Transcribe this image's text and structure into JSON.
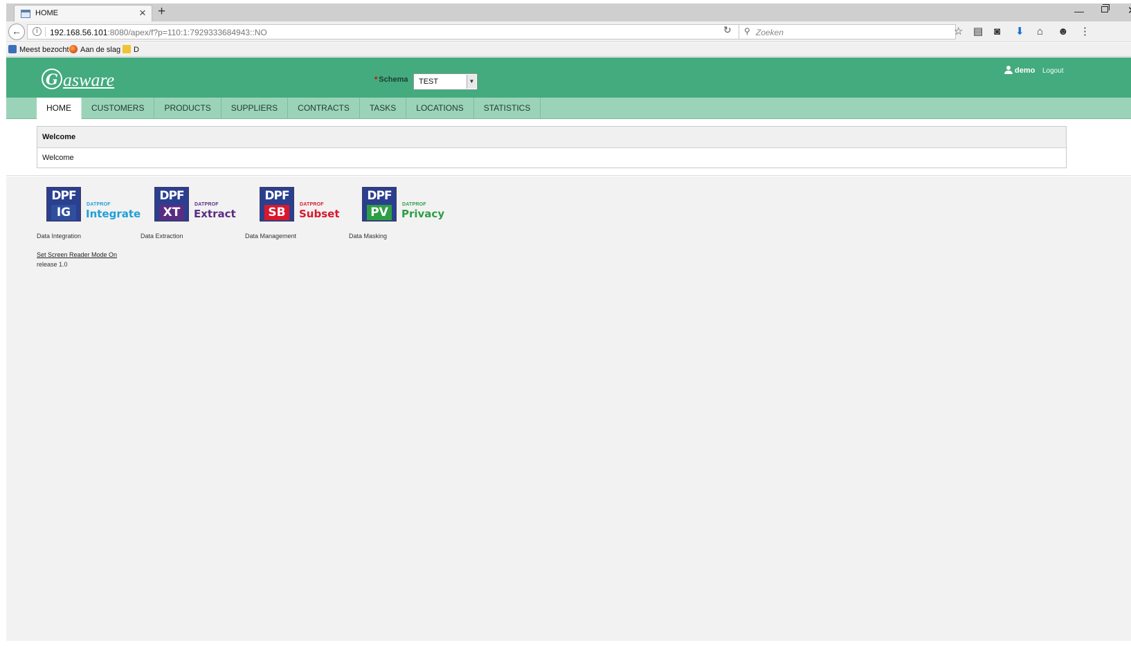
{
  "browser": {
    "tab_title": "HOME",
    "tab_close": "×",
    "new_tab": "+",
    "url_host": "192.168.56.101",
    "url_rest": ":8080/apex/f?p=110:1:7929333684943::NO",
    "search_placeholder": "Zoeken",
    "bookmarks": [
      "Meest bezocht",
      "Aan de slag",
      "D"
    ]
  },
  "header": {
    "logo_initial": "G",
    "logo_text": "asware",
    "schema_required": "*",
    "schema_label": "Schema",
    "schema_value": "TEST",
    "user": "demo",
    "logout": "Logout"
  },
  "nav": {
    "tabs": [
      {
        "label": "HOME"
      },
      {
        "label": "CUSTOMERS"
      },
      {
        "label": "PRODUCTS"
      },
      {
        "label": "SUPPLIERS"
      },
      {
        "label": "CONTRACTS"
      },
      {
        "label": "TASKS"
      },
      {
        "label": "LOCATIONS"
      },
      {
        "label": "STATISTICS"
      }
    ],
    "active": "HOME"
  },
  "welcome": {
    "title": "Welcome",
    "body": "Welcome"
  },
  "products": [
    {
      "badge_top": "DPF",
      "badge_code": "IG",
      "brand": "DATPROF",
      "name": "Integrate",
      "caption": "Data Integration",
      "color": "#1e9fd8",
      "badge_color": "#2f4f9e"
    },
    {
      "badge_top": "DPF",
      "badge_code": "XT",
      "brand": "DATPROF",
      "name": "Extract",
      "caption": "Data Extraction",
      "color": "#5a2d82",
      "badge_color": "#5a2d82"
    },
    {
      "badge_top": "DPF",
      "badge_code": "SB",
      "brand": "DATPROF",
      "name": "Subset",
      "caption": "Data Management",
      "color": "#d9182d",
      "badge_color": "#d9182d"
    },
    {
      "badge_top": "DPF",
      "badge_code": "PV",
      "brand": "DATPROF",
      "name": "Privacy",
      "caption": "Data Masking",
      "color": "#2e9e45",
      "badge_color": "#2e9e45"
    }
  ],
  "footer": {
    "screen_reader": "Set Screen Reader Mode On",
    "release": "release 1.0"
  },
  "colors": {
    "header_green": "#43ab7e",
    "nav_green": "#9bd3b9"
  }
}
